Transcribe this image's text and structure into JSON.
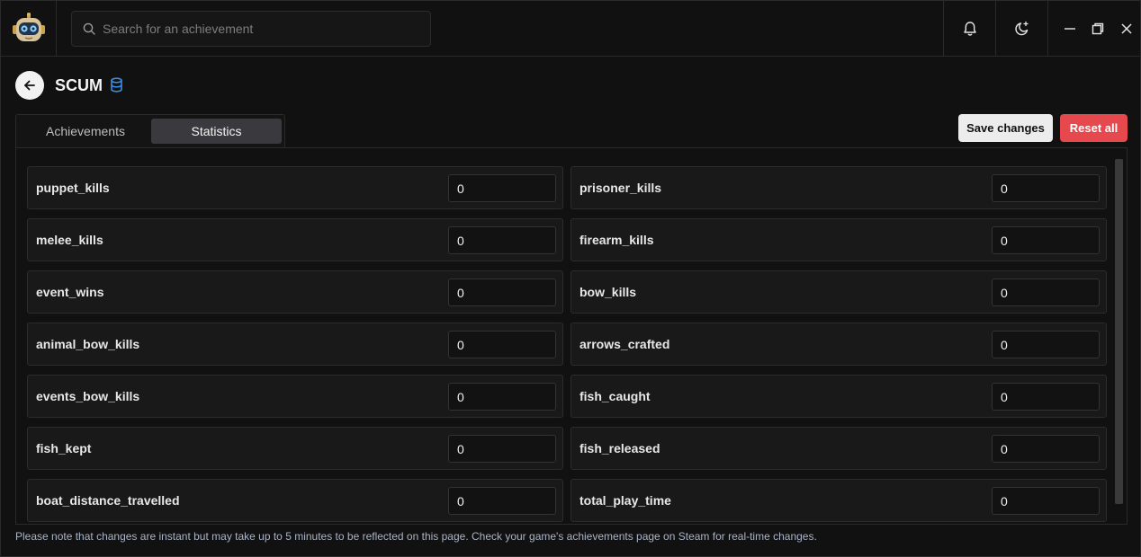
{
  "search": {
    "placeholder": "Search for an achievement"
  },
  "game": {
    "title": "SCUM"
  },
  "tabs": [
    {
      "label": "Achievements",
      "active": false
    },
    {
      "label": "Statistics",
      "active": true
    }
  ],
  "actions": {
    "save_label": "Save changes",
    "reset_label": "Reset all"
  },
  "colors": {
    "accent_blue": "#3a8ee6",
    "danger": "#e5484d"
  },
  "stats": [
    {
      "name": "puppet_kills",
      "value": "0"
    },
    {
      "name": "prisoner_kills",
      "value": "0"
    },
    {
      "name": "melee_kills",
      "value": "0"
    },
    {
      "name": "firearm_kills",
      "value": "0"
    },
    {
      "name": "event_wins",
      "value": "0"
    },
    {
      "name": "bow_kills",
      "value": "0"
    },
    {
      "name": "animal_bow_kills",
      "value": "0"
    },
    {
      "name": "arrows_crafted",
      "value": "0"
    },
    {
      "name": "events_bow_kills",
      "value": "0"
    },
    {
      "name": "fish_caught",
      "value": "0"
    },
    {
      "name": "fish_kept",
      "value": "0"
    },
    {
      "name": "fish_released",
      "value": "0"
    },
    {
      "name": "boat_distance_travelled",
      "value": "0"
    },
    {
      "name": "total_play_time",
      "value": "0"
    }
  ],
  "footer": {
    "note": "Please note that changes are instant but may take up to 5 minutes to be reflected on this page. Check your game's achievements page on Steam for real-time changes."
  }
}
